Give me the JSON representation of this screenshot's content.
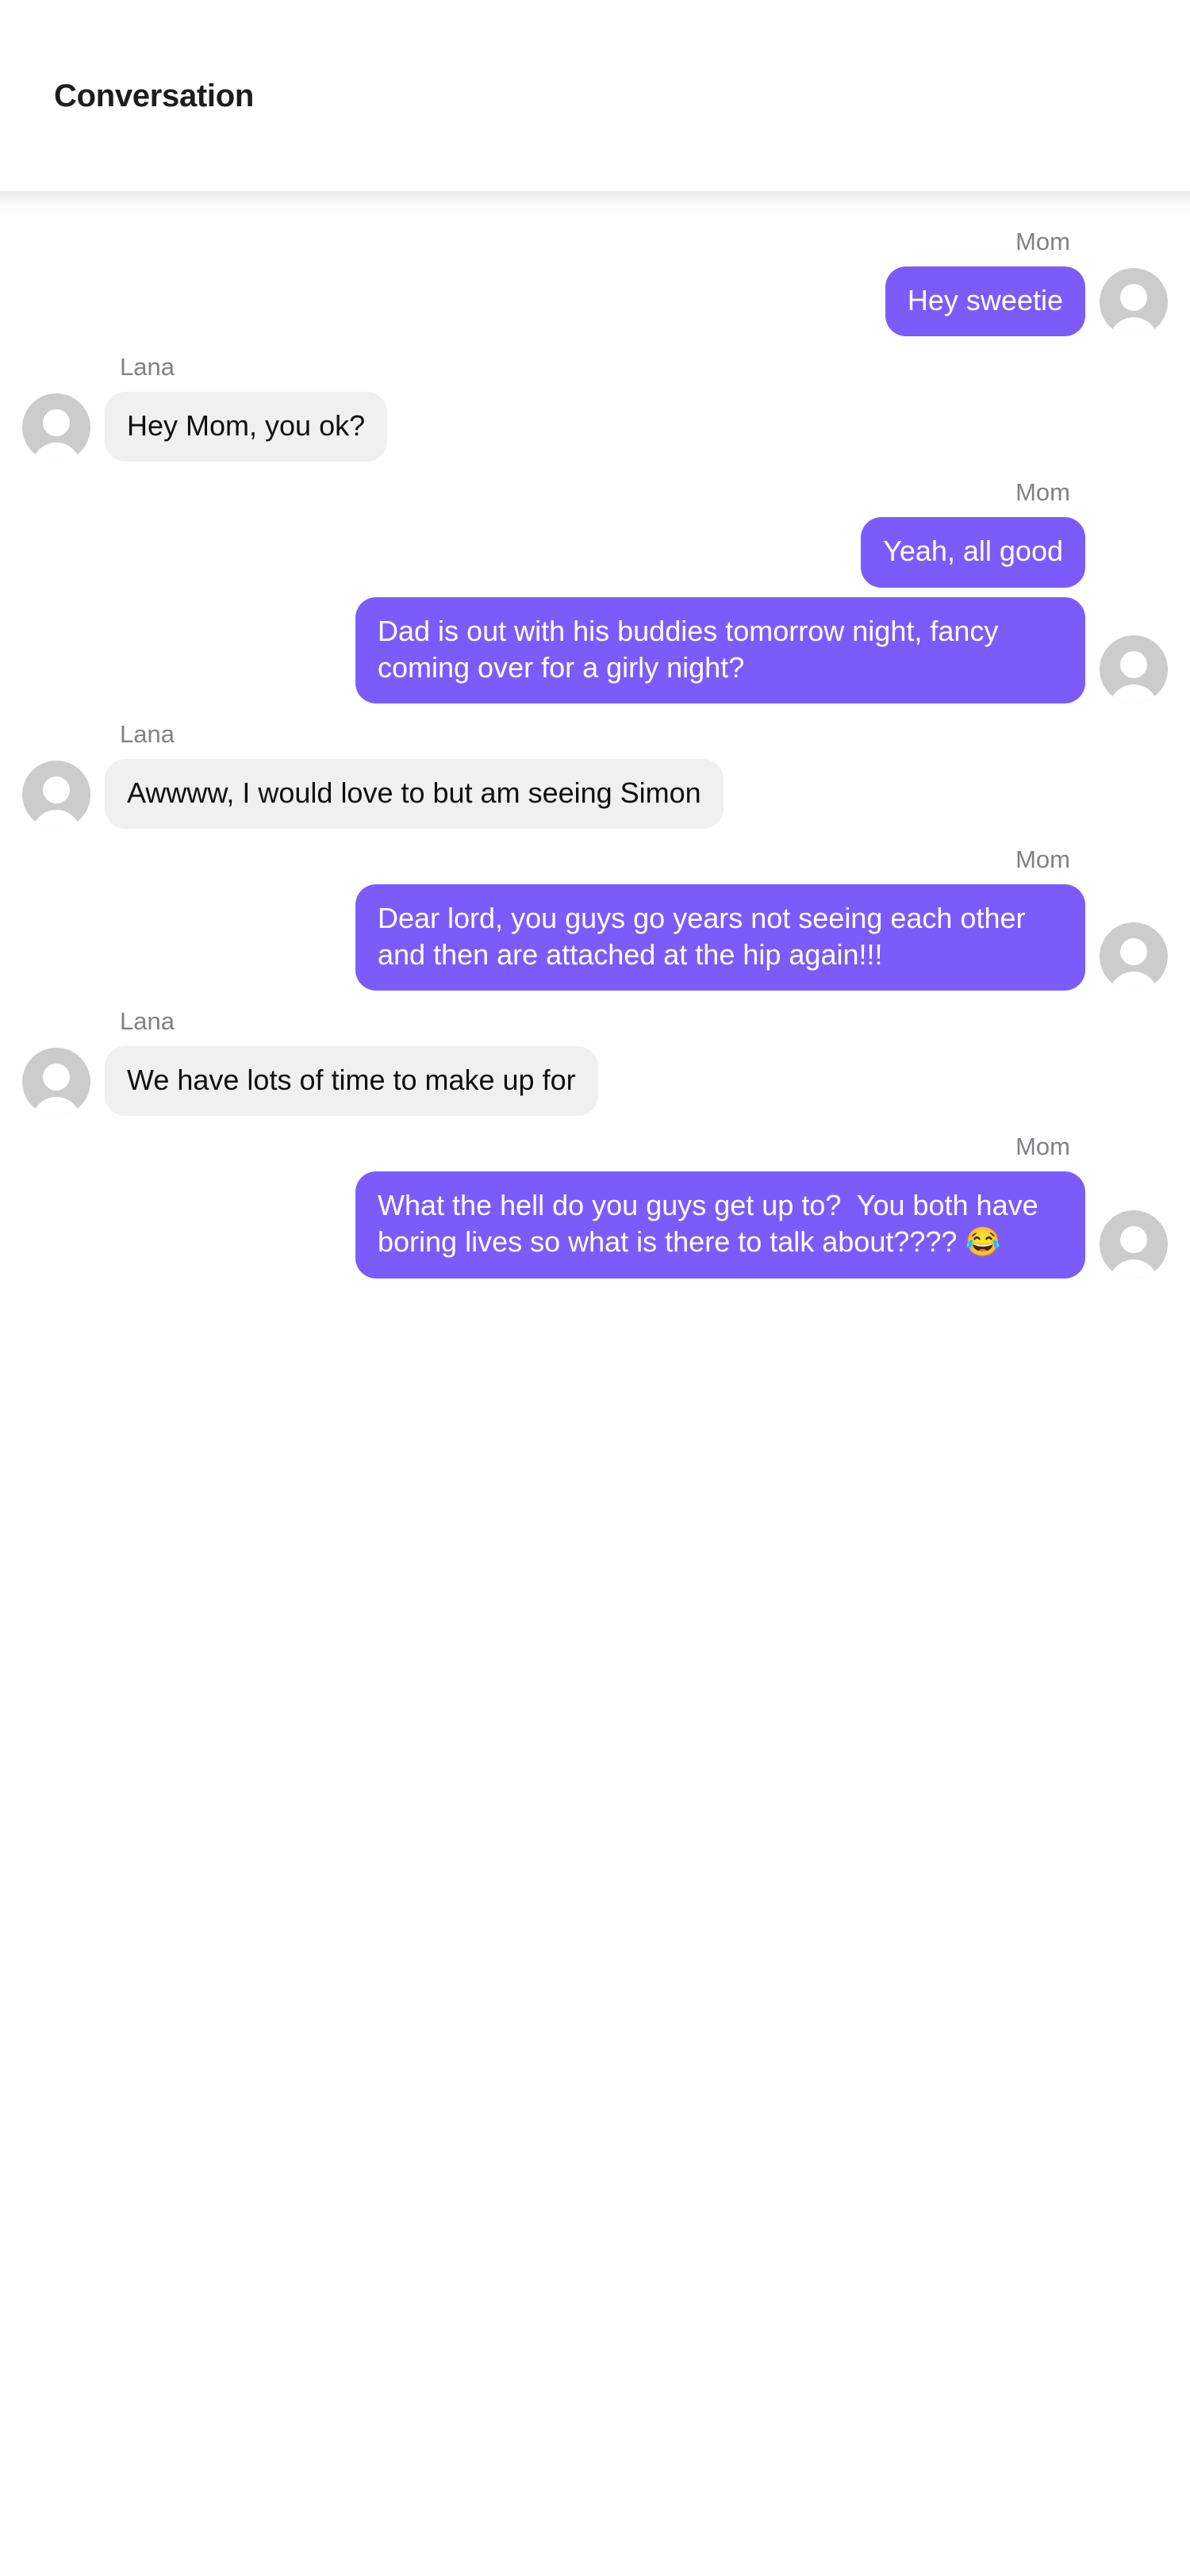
{
  "header": {
    "title": "Conversation"
  },
  "colors": {
    "outgoing_bubble": "#7b5cfa",
    "outgoing_text": "#ffffff",
    "incoming_bubble": "#f0f0f0",
    "incoming_text": "#101010",
    "sender_label": "#808285",
    "avatar": "#cccccc",
    "page_background": "#ffffff",
    "title_text": "#1d1d1f"
  },
  "participants": {
    "self": "Mom",
    "other": "Lana"
  },
  "groups": [
    {
      "sender": "Mom",
      "side": "right",
      "avatar_icon": "person-avatar-icon",
      "messages": [
        "Hey sweetie"
      ]
    },
    {
      "sender": "Lana",
      "side": "left",
      "avatar_icon": "person-avatar-icon",
      "messages": [
        "Hey Mom, you ok?"
      ]
    },
    {
      "sender": "Mom",
      "side": "right",
      "avatar_icon": "person-avatar-icon",
      "messages": [
        "Yeah, all good",
        "Dad is out with his buddies tomorrow night, fancy coming over for a girly night?"
      ]
    },
    {
      "sender": "Lana",
      "side": "left",
      "avatar_icon": "person-avatar-icon",
      "messages": [
        "Awwww, I would love to but am seeing Simon"
      ]
    },
    {
      "sender": "Mom",
      "side": "right",
      "avatar_icon": "person-avatar-icon",
      "messages": [
        "Dear lord, you guys go years not seeing each other and then are attached at the hip again!!!"
      ]
    },
    {
      "sender": "Lana",
      "side": "left",
      "avatar_icon": "person-avatar-icon",
      "messages": [
        "We have lots of time to make up for"
      ]
    },
    {
      "sender": "Mom",
      "side": "right",
      "avatar_icon": "person-avatar-icon",
      "messages": [
        "What the hell do you guys get up to?  You both have boring lives so what is there to talk about???? 😂"
      ]
    }
  ]
}
